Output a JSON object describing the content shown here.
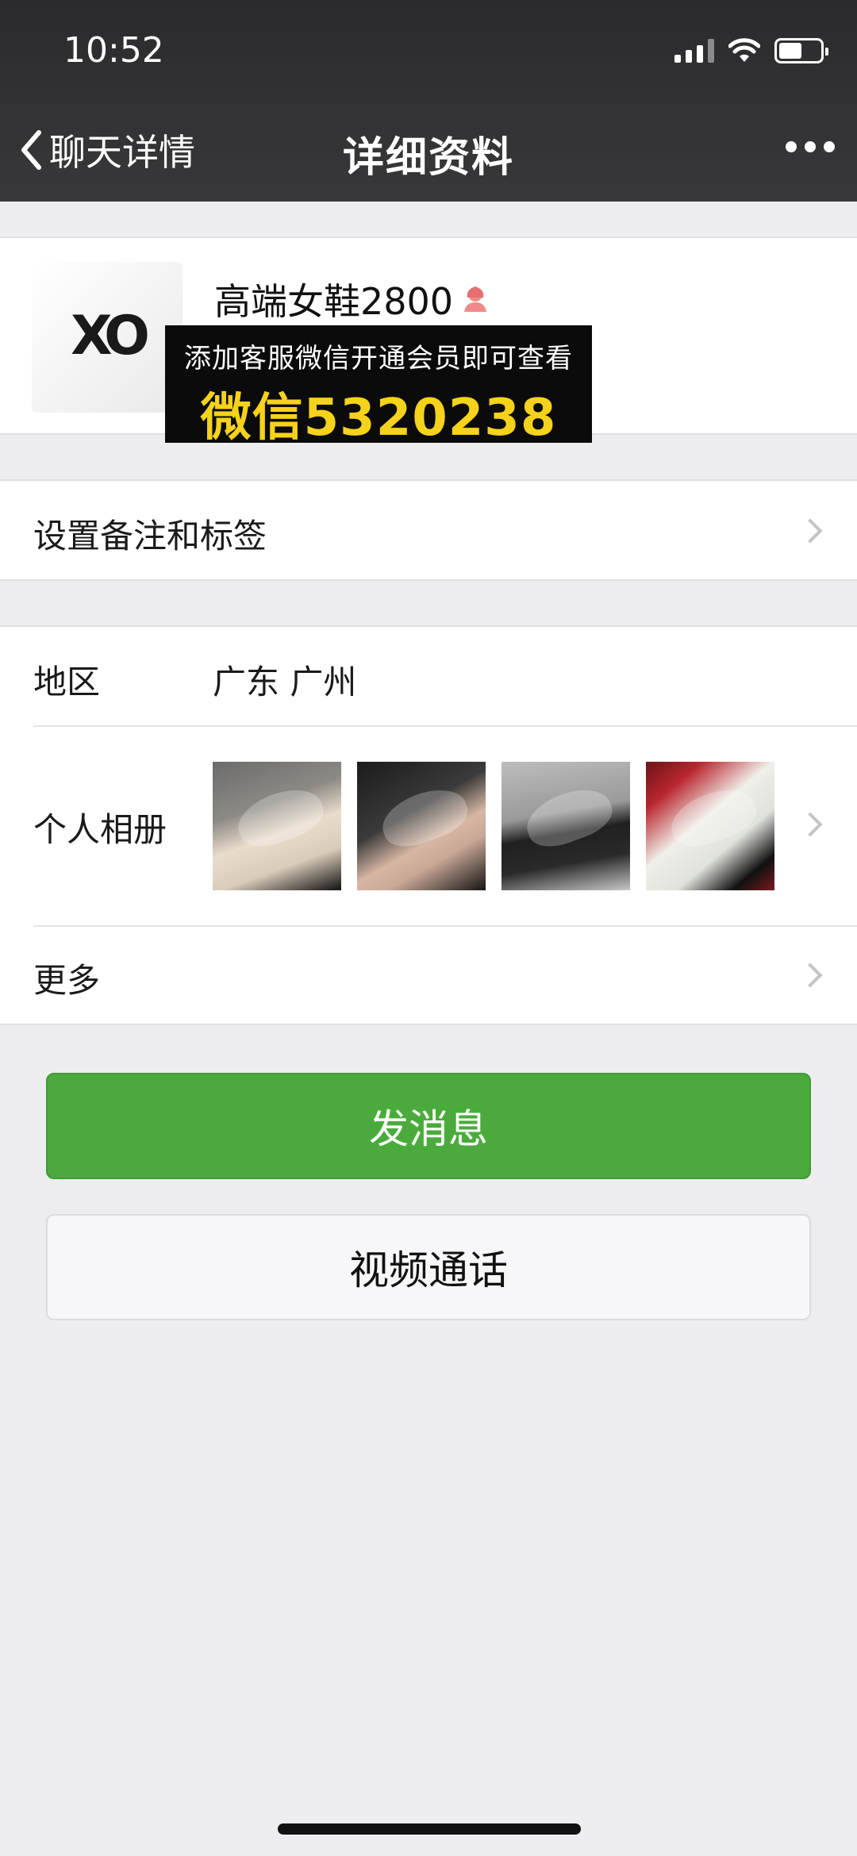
{
  "status_bar": {
    "time": "10:52"
  },
  "nav": {
    "back_label": "聊天详情",
    "title": "详细资料"
  },
  "profile": {
    "avatar_logo": "XO",
    "name": "高端女鞋2800",
    "gender_icon": "female-user-icon"
  },
  "promo": {
    "line1": "添加客服微信开通会员即可查看",
    "line2": "微信5320238"
  },
  "rows": {
    "remark_label": "设置备注和标签",
    "region_label": "地区",
    "region_value": "广东 广州",
    "album_label": "个人相册",
    "more_label": "更多"
  },
  "buttons": {
    "message": "发消息",
    "video_call": "视频通话"
  },
  "colors": {
    "nav_bg": "#2b2b2d",
    "primary_green": "#4aab3c",
    "promo_yellow": "#f5d21b",
    "page_bg": "#ededf0"
  }
}
